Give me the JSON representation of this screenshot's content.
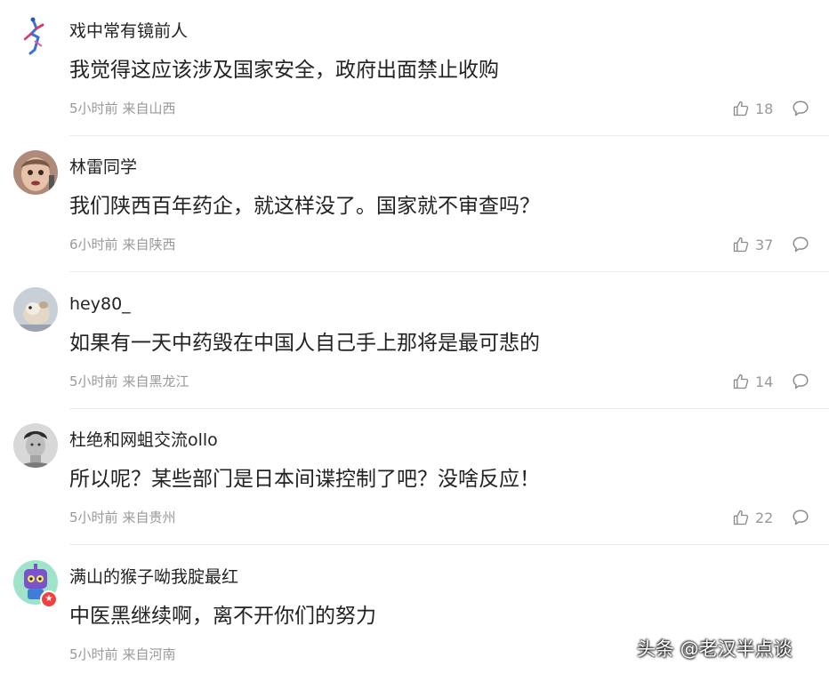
{
  "comments": [
    {
      "username": "戏中常有镜前人",
      "content": "我觉得这应该涉及国家安全，政府出面禁止收购",
      "time": "5小时前",
      "location": "来自山西",
      "likes": "18",
      "avatar_icon": "paper-figure-avatar"
    },
    {
      "username": "林雷同学",
      "content": "我们陕西百年药企，就这样没了。国家就不审查吗？",
      "time": "6小时前",
      "location": "来自陕西",
      "likes": "37",
      "avatar_icon": "child-face-avatar"
    },
    {
      "username": "hey80_",
      "content": "如果有一天中药毁在中国人自己手上那将是最可悲的",
      "time": "5小时前",
      "location": "来自黑龙江",
      "likes": "14",
      "avatar_icon": "hamster-avatar"
    },
    {
      "username": "杜绝和网蛆交流ollo",
      "content": "所以呢？某些部门是日本间谍控制了吧？没啥反应！",
      "time": "5小时前",
      "location": "来自贵州",
      "likes": "22",
      "avatar_icon": "bw-portrait-avatar"
    },
    {
      "username": "满山的猴子呦我腚最红",
      "content": "中医黑继续啊，离不开你们的努力",
      "time": "5小时前",
      "location": "来自河南",
      "likes": "",
      "avatar_icon": "cartoon-robot-avatar",
      "badge_icon": "red-star-badge-icon"
    }
  ],
  "watermark": "头条 @老汉半点谈",
  "colors": {
    "text_primary": "#222222",
    "text_meta": "#999999",
    "icon_gray": "#8a8a8a",
    "divider": "#ececec",
    "badge_red": "#f04142"
  }
}
